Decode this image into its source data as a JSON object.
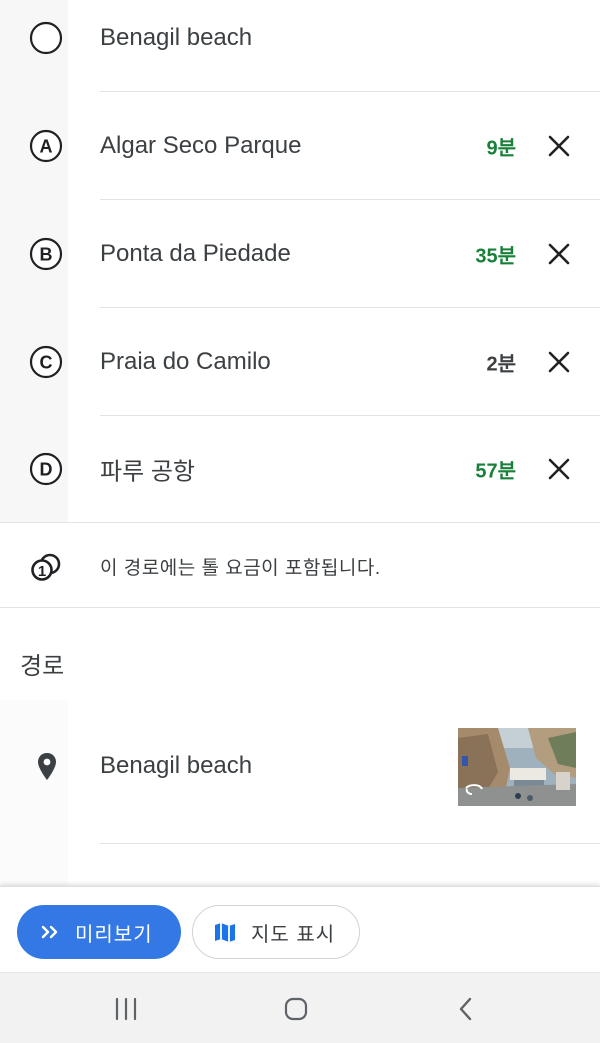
{
  "stops": [
    {
      "marker": "circle",
      "name": "Benagil beach",
      "duration": "",
      "duration_color": "",
      "removable": false
    },
    {
      "marker": "A",
      "name": "Algar Seco Parque",
      "duration": "9분",
      "duration_color": "#188038",
      "removable": true
    },
    {
      "marker": "B",
      "name": "Ponta da Piedade",
      "duration": "35분",
      "duration_color": "#188038",
      "removable": true
    },
    {
      "marker": "C",
      "name": "Praia do Camilo",
      "duration": "2분",
      "duration_color": "#3c4043",
      "removable": true
    },
    {
      "marker": "D",
      "name": "파루 공항",
      "duration": "57분",
      "duration_color": "#188038",
      "removable": true
    }
  ],
  "toll": {
    "icon": "toll-icon",
    "text": "이 경로에는 톨 요금이 포함됩니다."
  },
  "route_section": {
    "title": "경로",
    "item": {
      "icon": "location-pin-icon",
      "name": "Benagil beach",
      "thumbnail": "street-view-thumbnail"
    }
  },
  "actions": {
    "preview": {
      "icon": "double-chevron-right-icon",
      "label": "미리보기"
    },
    "show_map": {
      "icon": "map-icon",
      "label": "지도 표시"
    }
  },
  "nav": [
    "recent-apps-icon",
    "home-icon",
    "back-icon"
  ],
  "colors": {
    "accent": "#3478e5",
    "duration_green": "#188038",
    "text": "#3c4043"
  }
}
